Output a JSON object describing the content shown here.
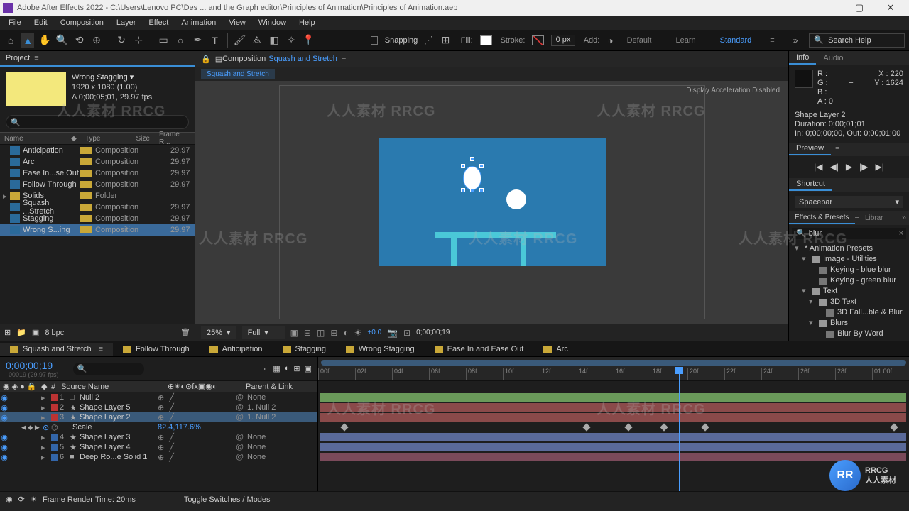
{
  "titlebar": {
    "title": "Adobe After Effects 2022 - C:\\Users\\Lenovo PC\\Des ... and the Graph editor\\Principles of Animation\\Principles of Animation.aep"
  },
  "menu": [
    "File",
    "Edit",
    "Composition",
    "Layer",
    "Effect",
    "Animation",
    "View",
    "Window",
    "Help"
  ],
  "toolbar": {
    "snapping": "Snapping",
    "fill": "Fill:",
    "stroke": "Stroke:",
    "stroke_px": "0 px",
    "add": "Add:",
    "workspaces": [
      "Default",
      "Learn",
      "Standard"
    ],
    "active_ws": "Standard",
    "search_ph": "Search Help"
  },
  "project": {
    "tab": "Project",
    "sel_name": "Wrong Stagging ▾",
    "sel_dims": "1920 x 1080 (1.00)",
    "sel_dur": "Δ 0;00;05;01, 29.97 fps",
    "cols": {
      "name": "Name",
      "type": "Type",
      "size": "Size",
      "fr": "Frame R..."
    },
    "items": [
      {
        "name": "Anticipation",
        "type": "Composition",
        "fr": "29.97",
        "kind": "comp"
      },
      {
        "name": "Arc",
        "type": "Composition",
        "fr": "29.97",
        "kind": "comp"
      },
      {
        "name": "Ease In...se Out",
        "type": "Composition",
        "fr": "29.97",
        "kind": "comp"
      },
      {
        "name": "Follow Through",
        "type": "Composition",
        "fr": "29.97",
        "kind": "comp"
      },
      {
        "name": "Solids",
        "type": "Folder",
        "fr": "",
        "kind": "folder"
      },
      {
        "name": "Squash ...Stretch",
        "type": "Composition",
        "fr": "29.97",
        "kind": "comp"
      },
      {
        "name": "Stagging",
        "type": "Composition",
        "fr": "29.97",
        "kind": "comp"
      },
      {
        "name": "Wrong S...ing",
        "type": "Composition",
        "fr": "29.97",
        "kind": "comp",
        "sel": true
      }
    ],
    "bpc": "8 bpc"
  },
  "comp": {
    "label": "Composition",
    "name": "Squash and Stretch",
    "crumb": "Squash and Stretch",
    "accel": "Display Acceleration Disabled",
    "zoom": "25%",
    "res": "Full",
    "exposure": "+0.0",
    "timecode": "0;00;00;19"
  },
  "info": {
    "tab_info": "Info",
    "tab_audio": "Audio",
    "r": "R :",
    "g": "G :",
    "b": "B :",
    "a": "A : 0",
    "x": "X : 220",
    "y": "Y : 1624",
    "layer": "Shape Layer 2",
    "dur": "Duration: 0;00;01;01",
    "inout": "In: 0;00;00;00, Out: 0;00;01;00"
  },
  "preview": {
    "tab": "Preview"
  },
  "shortcut": {
    "tab": "Shortcut",
    "val": "Spacebar"
  },
  "effects": {
    "tab_ep": "Effects & Presets",
    "tab_lib": "Librar",
    "search": "blur",
    "tree": [
      {
        "l": 0,
        "t": "* Animation Presets",
        "tw": "▾"
      },
      {
        "l": 1,
        "t": "Image - Utilities",
        "tw": "▾",
        "fld": true
      },
      {
        "l": 2,
        "t": "Keying - blue blur",
        "pst": true
      },
      {
        "l": 2,
        "t": "Keying - green blur",
        "pst": true
      },
      {
        "l": 1,
        "t": "Text",
        "tw": "▾",
        "fld": true
      },
      {
        "l": 2,
        "t": "3D Text",
        "tw": "▾",
        "fld": true
      },
      {
        "l": 3,
        "t": "3D Fall...ble & Blur",
        "pst": true
      },
      {
        "l": 2,
        "t": "Blurs",
        "tw": "▾",
        "fld": true
      },
      {
        "l": 3,
        "t": "Blur By Word",
        "pst": true
      }
    ]
  },
  "tl_tabs": [
    "Squash and Stretch",
    "Follow Through",
    "Anticipation",
    "Stagging",
    "Wrong Stagging",
    "Ease In and Ease Out",
    "Arc"
  ],
  "timeline": {
    "tc": "0;00;00;19",
    "fr": "00019 (29.97 fps)",
    "cols": {
      "src": "Source Name",
      "par": "Parent & Link"
    },
    "layers": [
      {
        "n": 1,
        "name": "Null 2",
        "clr": "#b33",
        "ico": "□",
        "par": "None"
      },
      {
        "n": 2,
        "name": "Shape Layer 5",
        "clr": "#b33",
        "ico": "★",
        "par": "1. Null 2"
      },
      {
        "n": 3,
        "name": "Shape Layer 2",
        "clr": "#b33",
        "ico": "★",
        "par": "1. Null 2",
        "sel": true
      },
      {
        "n": 4,
        "name": "Shape Layer 3",
        "clr": "#36a",
        "ico": "★",
        "par": "None"
      },
      {
        "n": 5,
        "name": "Shape Layer 4",
        "clr": "#36a",
        "ico": "★",
        "par": "None"
      },
      {
        "n": 6,
        "name": "Deep Ro...e Solid 1",
        "clr": "#36a",
        "ico": "■",
        "par": "None"
      }
    ],
    "prop": {
      "name": "Scale",
      "val": "82.4,117.6%"
    },
    "ruler": [
      "00f",
      "02f",
      "04f",
      "06f",
      "08f",
      "10f",
      "12f",
      "14f",
      "16f",
      "18f",
      "20f",
      "22f",
      "24f",
      "26f",
      "28f",
      "01:00f"
    ],
    "playhead_pct": 61,
    "kfs_pct": [
      4,
      45,
      52,
      58,
      65,
      97
    ],
    "track_colors": [
      "#6a9a5a",
      "#8a4a4a",
      "#8a4a4a",
      "#5a6a9a",
      "#5a6a9a",
      "#7a4a5a"
    ]
  },
  "footer": {
    "frt": "Frame Render Time: 20ms",
    "tog": "Toggle Switches / Modes"
  },
  "brand": {
    "logo": "RR",
    "name": "RRCG",
    "sub": "人人素材"
  },
  "watermarks": [
    "人人素材 RRCG",
    "人人素材 RRCG",
    "人人素材 RRCG",
    "人人素材 RRCG",
    "人人素材 RRCG",
    "人人素材 RRCG",
    "人人素材 RRCG",
    "人人素材 RRCG"
  ]
}
